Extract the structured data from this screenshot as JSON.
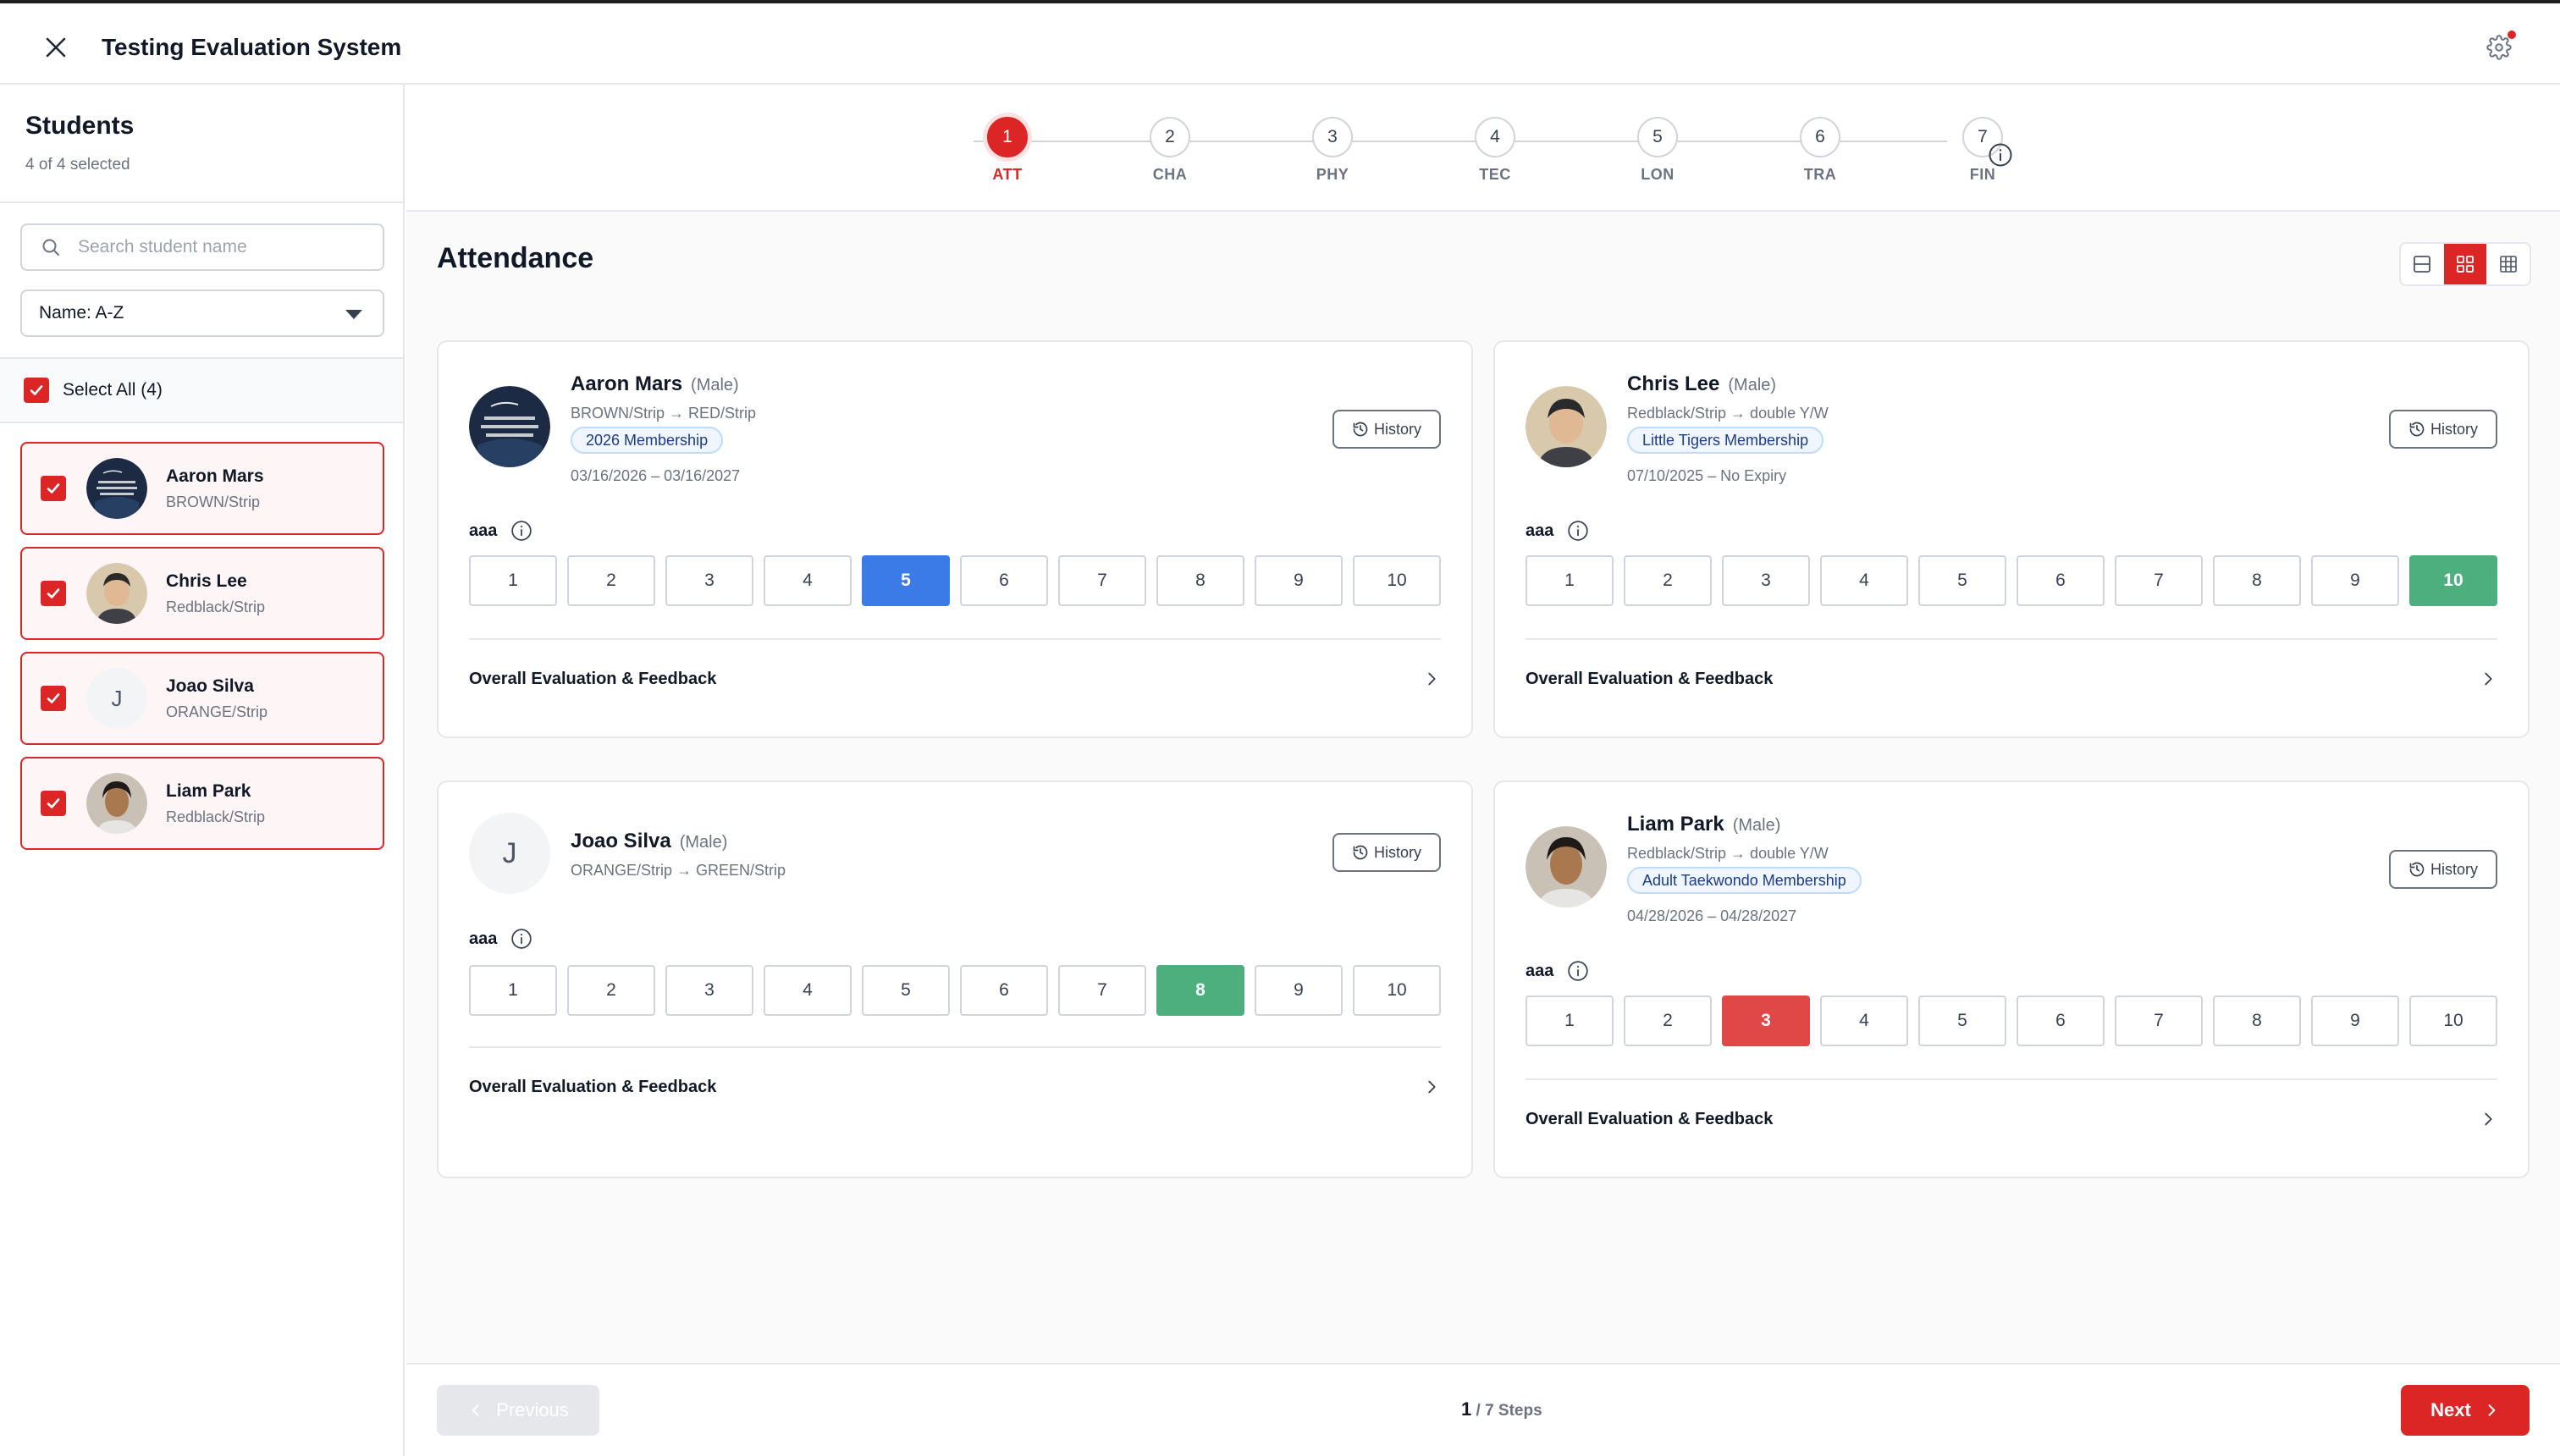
{
  "app": {
    "title": "Testing Evaluation System"
  },
  "sidebar": {
    "title": "Students",
    "selected_text": "4 of 4 selected",
    "search_placeholder": "Search student name",
    "sort_value": "Name: A-Z",
    "select_all_label": "Select All (4)",
    "students": [
      {
        "name": "Aaron Mars",
        "belt": "BROWN/Strip",
        "checked": true
      },
      {
        "name": "Chris Lee",
        "belt": "Redblack/Strip",
        "checked": true
      },
      {
        "name": "Joao Silva",
        "belt": "ORANGE/Strip",
        "initial": "J",
        "checked": true
      },
      {
        "name": "Liam Park",
        "belt": "Redblack/Strip",
        "checked": true
      }
    ]
  },
  "stepper": {
    "current": 1,
    "steps": [
      {
        "num": "1",
        "label": "ATT"
      },
      {
        "num": "2",
        "label": "CHA"
      },
      {
        "num": "3",
        "label": "PHY"
      },
      {
        "num": "4",
        "label": "TEC"
      },
      {
        "num": "5",
        "label": "LON"
      },
      {
        "num": "6",
        "label": "TRA"
      },
      {
        "num": "7",
        "label": "FIN"
      }
    ]
  },
  "main": {
    "section_title": "Attendance",
    "view_mode": "grid",
    "history_label": "History",
    "feedback_label": "Overall Evaluation & Feedback",
    "scores": [
      "1",
      "2",
      "3",
      "4",
      "5",
      "6",
      "7",
      "8",
      "9",
      "10"
    ],
    "cards": [
      {
        "name": "Aaron Mars",
        "gender": "(Male)",
        "belt_change": "BROWN/Strip → RED/Strip",
        "membership": "2026 Membership",
        "dates": "03/16/2026 – 03/16/2027",
        "criterion": "aaa",
        "selected_score": 5,
        "selected_color": "#3b7be8"
      },
      {
        "name": "Chris Lee",
        "gender": "(Male)",
        "belt_change": "Redblack/Strip → double Y/W",
        "membership": "Little Tigers Membership",
        "dates": "07/10/2025 – No Expiry",
        "criterion": "aaa",
        "selected_score": 10,
        "selected_color": "#4caf7d"
      },
      {
        "name": "Joao Silva",
        "gender": "(Male)",
        "initial": "J",
        "belt_change": "ORANGE/Strip → GREEN/Strip",
        "criterion": "aaa",
        "selected_score": 8,
        "selected_color": "#4caf7d"
      },
      {
        "name": "Liam Park",
        "gender": "(Male)",
        "belt_change": "Redblack/Strip → double Y/W",
        "membership": "Adult Taekwondo Membership",
        "dates": "04/28/2026 – 04/28/2027",
        "criterion": "aaa",
        "selected_score": 3,
        "selected_color": "#e04848"
      }
    ]
  },
  "footer": {
    "previous_label": "Previous",
    "next_label": "Next",
    "page_current": "1",
    "page_total": "/ 7 Steps"
  },
  "colors": {
    "accent": "#dc2626",
    "score_blue": "#3b7be8",
    "score_green": "#4caf7d",
    "score_red": "#e04848",
    "badge_bg": "#eff6ff"
  },
  "icons": [
    "close-icon",
    "gear-icon",
    "search-icon",
    "chevron-down-icon",
    "check-icon",
    "info-icon",
    "history-icon",
    "chevron-right-icon",
    "chevron-left-icon",
    "list-view-icon",
    "grid-view-icon",
    "table-view-icon"
  ]
}
